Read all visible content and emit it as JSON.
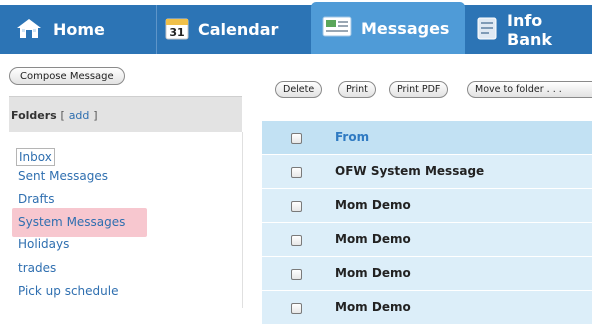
{
  "nav": {
    "tabs": [
      {
        "label": "Home",
        "icon": "home-icon"
      },
      {
        "label": "Calendar",
        "icon": "calendar-icon",
        "icon_text": "31"
      },
      {
        "label": "Messages",
        "icon": "messages-icon",
        "active": true
      },
      {
        "label": "Info Bank",
        "icon": "info-bank-icon"
      }
    ],
    "colors": {
      "bar": "#2c74b5",
      "active_tab": "#4f9bd7"
    }
  },
  "sidebar": {
    "compose_label": "Compose Message",
    "folders_title": "Folders",
    "bracket_open": "[",
    "add_label": "add",
    "bracket_close": "]",
    "folders": [
      "Inbox",
      "Sent Messages",
      "Drafts",
      "System Messages",
      "Holidays",
      "trades",
      "Pick up schedule"
    ],
    "selected_folder": "Inbox",
    "highlighted_folder": "System Messages",
    "highlight_color": "#f7c7cf"
  },
  "toolbar": {
    "delete_label": "Delete",
    "print_label": "Print",
    "print_pdf_label": "Print PDF",
    "move_label": "Move to folder . . ."
  },
  "messages": {
    "column_from": "From",
    "rows": [
      {
        "from": "OFW System Message"
      },
      {
        "from": "Mom Demo"
      },
      {
        "from": "Mom Demo"
      },
      {
        "from": "Mom Demo"
      },
      {
        "from": "Mom Demo"
      }
    ]
  }
}
